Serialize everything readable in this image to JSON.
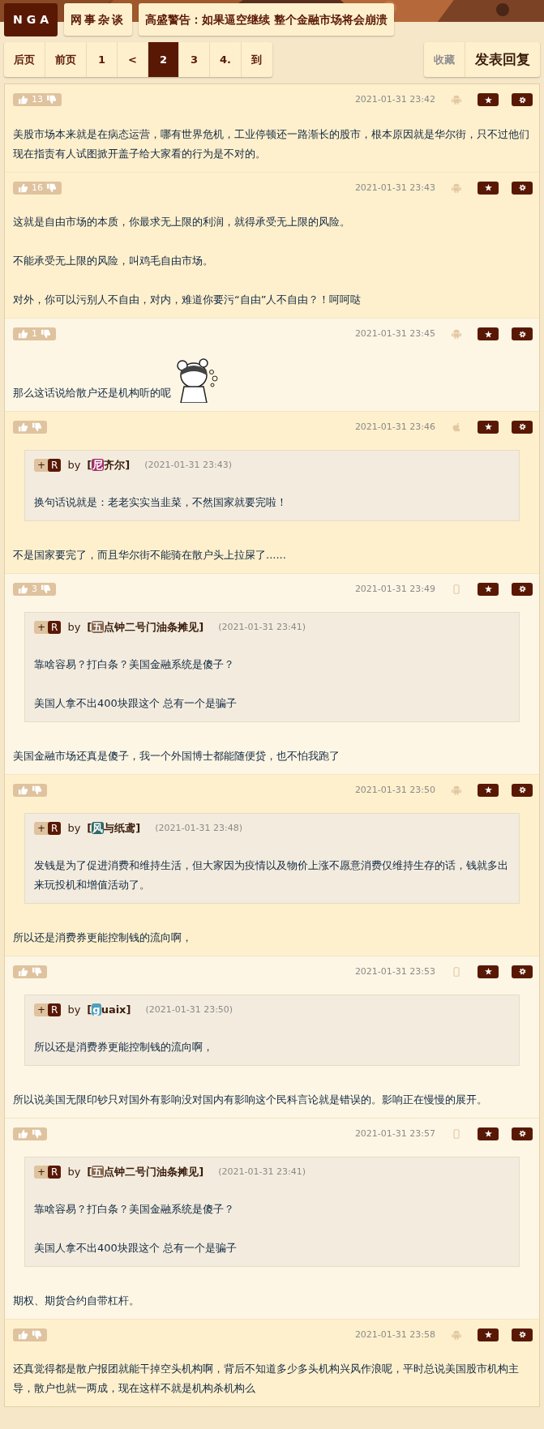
{
  "header": {
    "logo": "NGA",
    "forum": "网事杂谈",
    "title": "高盛警告：如果逼空继续 整个金融市场将会崩溃"
  },
  "pager": [
    {
      "label": "后页",
      "selected": false
    },
    {
      "label": "前页",
      "selected": false
    },
    {
      "label": "1",
      "selected": false
    },
    {
      "label": "<",
      "selected": false
    },
    {
      "label": "2",
      "selected": true
    },
    {
      "label": "3",
      "selected": false
    },
    {
      "label": "4.",
      "selected": false
    },
    {
      "label": "到",
      "selected": false
    }
  ],
  "actions": [
    {
      "label": "收藏",
      "kind": "muted"
    },
    {
      "label": "发表回复",
      "kind": "primary"
    }
  ],
  "posts": [
    {
      "highlighted": true,
      "votes": "13",
      "time": "2021-01-31 23:42",
      "client": {
        "kind": "android"
      },
      "paragraphs": [
        "美股市场本来就是在病态运营，哪有世界危机，工业停顿还一路渐长的股市，根本原因就是华尔街，只不过他们现在指责有人试图掀开盖子给大家看的行为是不对的。"
      ]
    },
    {
      "highlighted": true,
      "votes": "16",
      "time": "2021-01-31 23:43",
      "client": {
        "kind": "android"
      },
      "paragraphs": [
        "这就是自由市场的本质，你最求无上限的利润，就得承受无上限的风险。",
        "不能承受无上限的风险，叫鸡毛自由市场。",
        "对外，你可以污别人不自由，对内，难道你要污“自由”人不自由？！呵呵哒"
      ]
    },
    {
      "highlighted": false,
      "votes": "1",
      "time": "2021-01-31 23:45",
      "client": {
        "kind": "android"
      },
      "paragraphs": [
        "那么这话说给散户还是机构听的呢"
      ],
      "sticker": {
        "kind": "picture"
      }
    },
    {
      "highlighted": true,
      "time": "2021-01-31 23:46",
      "client": {
        "kind": "apple"
      },
      "quote": {
        "tag_plus": "+",
        "tag_letter": "R",
        "by": "by",
        "bracket_open": "[",
        "bracket_close": "]",
        "initial": "尼",
        "color": "#a3306c",
        "name": "齐尔",
        "time": "(2021-01-31 23:43)",
        "paragraphs": [
          "换句话说就是：老老实实当韭菜，不然国家就要完啦！"
        ]
      },
      "paragraphs": [
        "不是国家要完了，而且华尔街不能骑在散户头上拉屎了......"
      ]
    },
    {
      "highlighted": false,
      "votes": "3",
      "time": "2021-01-31 23:49",
      "client": {
        "kind": "phone"
      },
      "quote": {
        "tag_plus": "+",
        "tag_letter": "R",
        "by": "by",
        "bracket_open": "[",
        "bracket_close": "]",
        "initial": "五",
        "color": "#8a6a52",
        "name": "点钟二号门油条摊见",
        "time": "(2021-01-31 23:41)",
        "paragraphs": [
          "靠啥容易？打白条？美国金融系统是傻子？",
          "美国人拿不出400块跟这个 总有一个是骗子"
        ]
      },
      "paragraphs": [
        "美国金融市场还真是傻子，我一个外国博士都能随便贷，也不怕我跑了"
      ]
    },
    {
      "highlighted": true,
      "time": "2021-01-31 23:50",
      "client": {
        "kind": "android"
      },
      "quote": {
        "tag_plus": "+",
        "tag_letter": "R",
        "by": "by",
        "bracket_open": "[",
        "bracket_close": "]",
        "initial": "风",
        "color": "#2f6868",
        "name": "与纸鸢",
        "time": "(2021-01-31 23:48)",
        "paragraphs": [
          "发钱是为了促进消费和维持生活，但大家因为疫情以及物价上涨不愿意消费仅维持生存的话，钱就多出来玩投机和增值活动了。"
        ]
      },
      "paragraphs": [
        "所以还是消费券更能控制钱的流向啊，"
      ]
    },
    {
      "highlighted": false,
      "time": "2021-01-31 23:53",
      "client": {
        "kind": "phone"
      },
      "quote": {
        "tag_plus": "+",
        "tag_letter": "R",
        "by": "by",
        "bracket_open": "[",
        "bracket_close": "]",
        "initial": "g",
        "color": "#4f9fc0",
        "name": "uaix",
        "time": "(2021-01-31 23:50)",
        "paragraphs": [
          "所以还是消费券更能控制钱的流向啊，"
        ]
      },
      "paragraphs": [
        "所以说美国无限印钞只对国外有影响没对国内有影响这个民科言论就是错误的。影响正在慢慢的展开。"
      ]
    },
    {
      "highlighted": false,
      "time": "2021-01-31 23:57",
      "client": {
        "kind": "phone"
      },
      "quote": {
        "tag_plus": "+",
        "tag_letter": "R",
        "by": "by",
        "bracket_open": "[",
        "bracket_close": "]",
        "initial": "五",
        "color": "#8a6a52",
        "name": "点钟二号门油条摊见",
        "time": "(2021-01-31 23:41)",
        "paragraphs": [
          "靠啥容易？打白条？美国金融系统是傻子？",
          "美国人拿不出400块跟这个 总有一个是骗子"
        ]
      },
      "paragraphs": [
        "期权、期货合约自带杠杆。"
      ]
    },
    {
      "highlighted": true,
      "time": "2021-01-31 23:58",
      "client": {
        "kind": "android"
      },
      "paragraphs": [
        "还真觉得都是散户报团就能干掉空头机构啊，背后不知道多少多头机构兴风作浪呢，平时总说美国股市机构主导，散户也就一两成，现在这样不就是机构杀机构么"
      ]
    }
  ]
}
